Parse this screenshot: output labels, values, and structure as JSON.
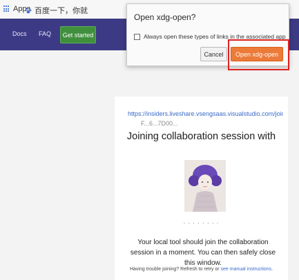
{
  "bookmarks": {
    "apps_label": "Apps",
    "baidu_label": "百度一下，你就"
  },
  "navbar": {
    "docs_label": "Docs",
    "faq_label": "FAQ",
    "get_started_label": "Get started",
    "background": "#3d3a85",
    "button_color": "#3f8f3d"
  },
  "dialog": {
    "title": "Open xdg-open?",
    "checkbox_label": "Always open these types of links in the associated app",
    "checkbox_checked": false,
    "cancel_label": "Cancel",
    "open_label": "Open xdg-open",
    "open_color": "#ec7a38",
    "highlight_color": "#e02020"
  },
  "content": {
    "url_line_1": "https://insiders.liveshare.vsengsaas.visualstudio.com/join?",
    "url_line_2": "F...6...7D00...",
    "heading": "Joining collaboration session with",
    "user_name": "· · · ·  · · · ·",
    "info_text": "Your local tool should join the collaboration session in a moment. You can then safely close this window.",
    "trouble_prefix": "Having trouble joining? Refresh to retry or",
    "trouble_link": "see manual instructions",
    "trouble_suffix": "."
  }
}
